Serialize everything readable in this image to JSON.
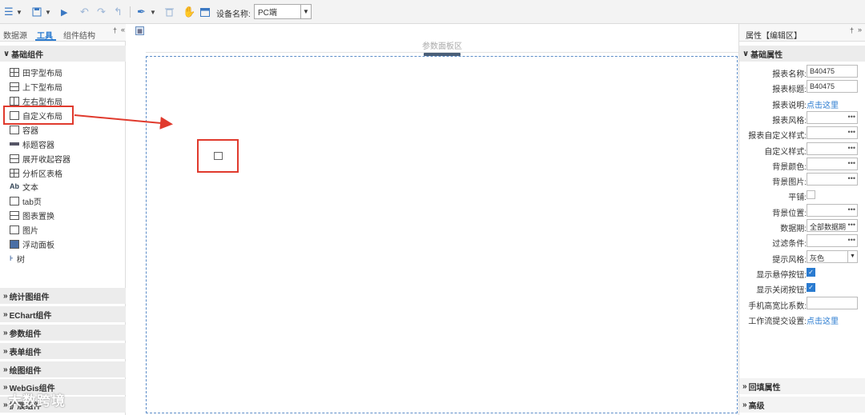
{
  "toolbar": {
    "device_label": "设备名称:",
    "device_value": "PC端",
    "icons": [
      "menu-icon",
      "save-icon",
      "play-icon",
      "undo-icon",
      "redo-icon",
      "return-icon",
      "paint-icon",
      "delete-icon",
      "hand-icon",
      "window-icon"
    ]
  },
  "left_panel": {
    "tabs": [
      "数据源",
      "工具",
      "组件结构"
    ],
    "active_tab": "工具",
    "basic_section": "基础组件",
    "components": [
      {
        "label": "田字型布局",
        "icon": "grid-layout-icon"
      },
      {
        "label": "上下型布局",
        "icon": "vertical-layout-icon"
      },
      {
        "label": "左右型布局",
        "icon": "horizontal-layout-icon"
      },
      {
        "label": "自定义布局",
        "icon": "custom-layout-icon"
      },
      {
        "label": "容器",
        "icon": "container-icon"
      },
      {
        "label": "标题容器",
        "icon": "title-container-icon"
      },
      {
        "label": "展开收起容器",
        "icon": "collapse-container-icon"
      },
      {
        "label": "分析区表格",
        "icon": "table-icon"
      },
      {
        "label": "文本",
        "icon": "text-icon"
      },
      {
        "label": "tab页",
        "icon": "tab-icon"
      },
      {
        "label": "图表置换",
        "icon": "chart-swap-icon"
      },
      {
        "label": "图片",
        "icon": "image-icon"
      },
      {
        "label": "浮动面板",
        "icon": "float-panel-icon"
      },
      {
        "label": "树",
        "icon": "tree-icon"
      }
    ],
    "sections": [
      "统计图组件",
      "EChart组件",
      "参数组件",
      "表单组件",
      "绘图组件",
      "WebGis组件",
      "扩展组件"
    ]
  },
  "canvas": {
    "param_area": "参数面板区"
  },
  "right_panel": {
    "title": "属性【编辑区】",
    "basic_section": "基础属性",
    "props": [
      {
        "label": "报表名称:",
        "type": "text",
        "value": "B40475"
      },
      {
        "label": "报表标题:",
        "type": "text",
        "value": "B40475"
      },
      {
        "label": "报表说明:",
        "type": "link",
        "value": "点击这里"
      },
      {
        "label": "报表风格:",
        "type": "dots",
        "value": ""
      },
      {
        "label": "报表自定义样式:",
        "type": "dots",
        "value": ""
      },
      {
        "label": "自定义样式:",
        "type": "dots",
        "value": ""
      },
      {
        "label": "背景颜色:",
        "type": "dots",
        "value": ""
      },
      {
        "label": "背景图片:",
        "type": "dots",
        "value": ""
      },
      {
        "label": "平铺:",
        "type": "checkbox",
        "value": ""
      },
      {
        "label": "背景位置:",
        "type": "dots",
        "value": ""
      },
      {
        "label": "数据期:",
        "type": "dots",
        "value": "全部数据期"
      },
      {
        "label": "过滤条件:",
        "type": "dots",
        "value": ""
      },
      {
        "label": "提示风格:",
        "type": "select",
        "value": "灰色"
      },
      {
        "label": "显示悬停按钮:",
        "type": "checked",
        "value": ""
      },
      {
        "label": "显示关闭按钮:",
        "type": "checked",
        "value": ""
      },
      {
        "label": "手机高宽比系数:",
        "type": "text",
        "value": ""
      },
      {
        "label": "工作流提交设置:",
        "type": "link",
        "value": "点击这里"
      }
    ],
    "sections": [
      "回填属性",
      "高级"
    ]
  },
  "watermark": "大数跨境",
  "colors": {
    "accent": "#2a7bd0",
    "annotation": "#e03a2d",
    "design_border": "#5b8cc8"
  }
}
